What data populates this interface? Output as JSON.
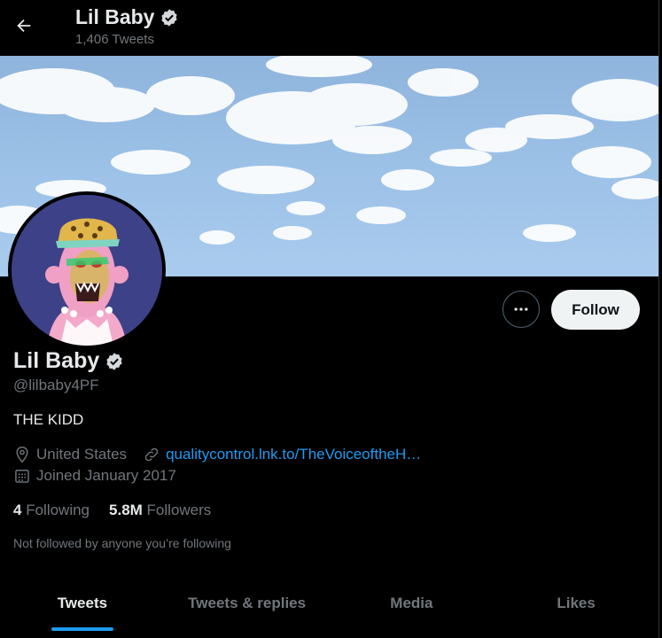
{
  "header": {
    "title": "Lil Baby",
    "tweet_count": "1,406 Tweets"
  },
  "profile": {
    "name": "Lil Baby",
    "handle": "@lilbaby4PF",
    "bio": "THE KIDD",
    "location": "United States",
    "website": "qualitycontrol.lnk.to/TheVoiceoftheH…",
    "joined": "Joined January 2017",
    "following_count": "4",
    "following_label": "Following",
    "followers_count": "5.8M",
    "followers_label": "Followers",
    "not_followed_note": "Not followed by anyone you’re following"
  },
  "actions": {
    "follow_label": "Follow"
  },
  "tabs": [
    {
      "label": "Tweets",
      "active": true
    },
    {
      "label": "Tweets & replies",
      "active": false
    },
    {
      "label": "Media",
      "active": false
    },
    {
      "label": "Likes",
      "active": false
    }
  ],
  "colors": {
    "background": "#000000",
    "accent": "#1d9bf0",
    "muted": "#71767b",
    "text": "#e7e9ea",
    "follow_bg": "#eff3f4"
  },
  "icons": [
    "back-arrow-icon",
    "verified-badge-icon",
    "more-icon",
    "location-icon",
    "link-icon",
    "calendar-icon"
  ]
}
